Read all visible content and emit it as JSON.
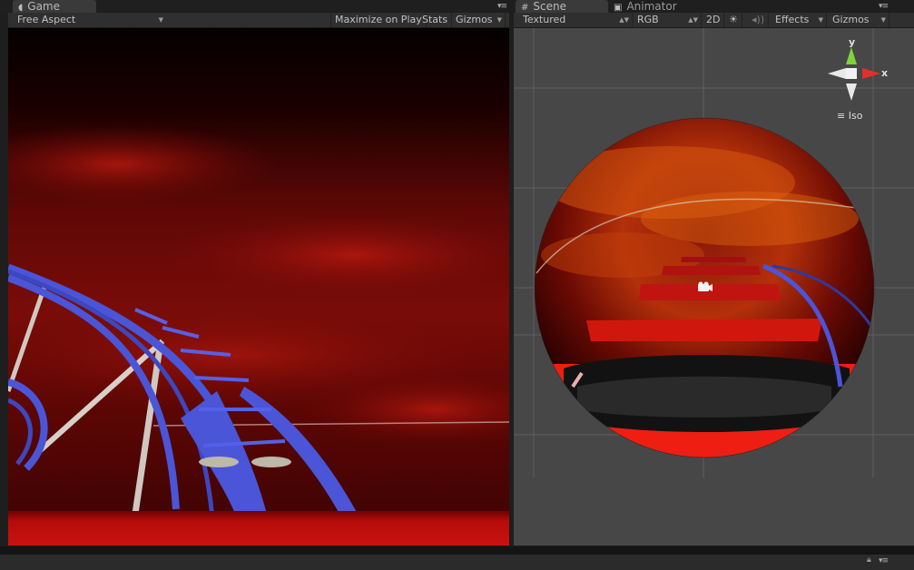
{
  "game_panel": {
    "tab_label": "Game",
    "aspect": "Free Aspect",
    "maximize_label": "Maximize on Play",
    "stats_label": "Stats",
    "gizmos_label": "Gizmos"
  },
  "scene_panel": {
    "tab_label": "Scene",
    "animator_tab_label": "Animator",
    "render_mode": "Textured",
    "color_mode": "RGB",
    "mode_2d_label": "2D",
    "effects_label": "Effects",
    "gizmos_label": "Gizmos",
    "orientation": {
      "y_label": "y",
      "x_label": "x",
      "projection_label": "Iso"
    }
  },
  "icons": {
    "game": "game-controller-icon",
    "scene": "grid-icon",
    "animator": "animator-icon",
    "sun": "sun-icon",
    "audio": "audio-icon",
    "camera": "camera-icon",
    "lock": "lock-icon",
    "menu": "panel-menu-icon"
  },
  "colors": {
    "accent_red": "#ee1e12",
    "track_blue": "#4a55d8",
    "axis_y": "#7fd23a",
    "axis_x": "#e0312a"
  }
}
